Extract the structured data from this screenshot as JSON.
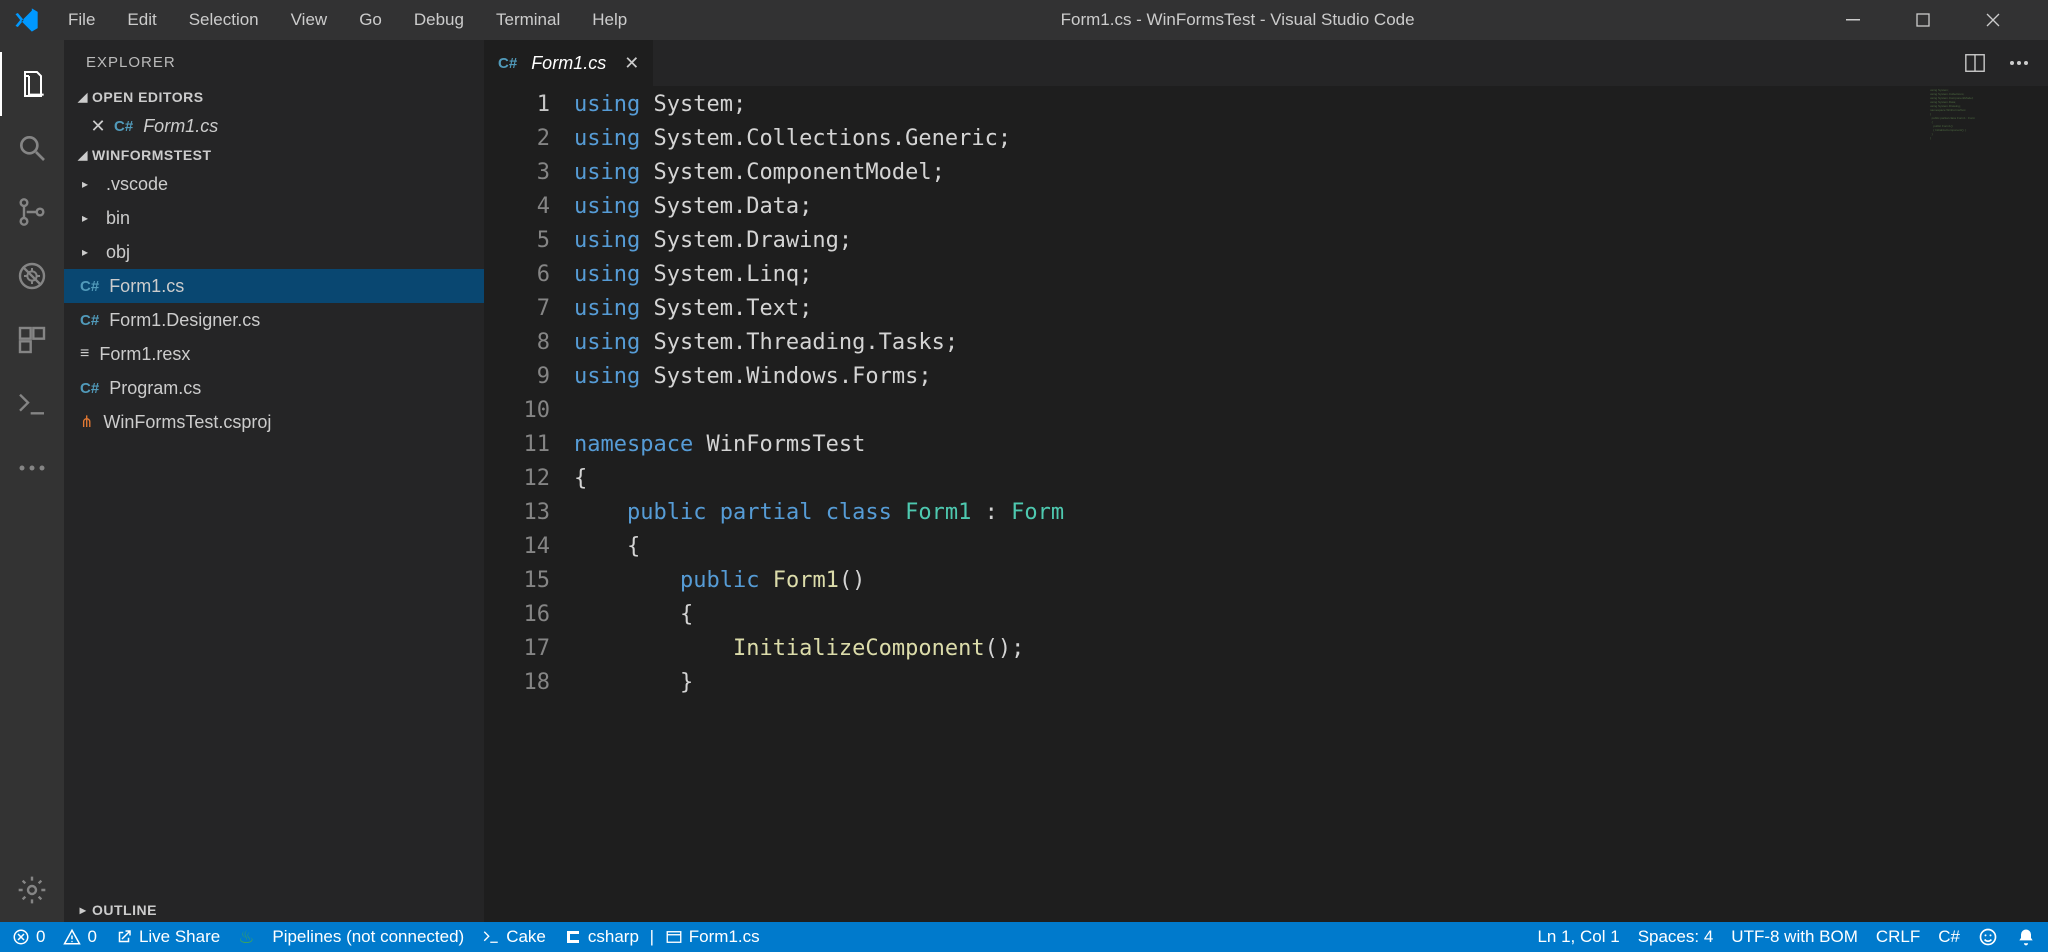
{
  "menu": {
    "items": [
      "File",
      "Edit",
      "Selection",
      "View",
      "Go",
      "Debug",
      "Terminal",
      "Help"
    ]
  },
  "window": {
    "title": "Form1.cs - WinFormsTest - Visual Studio Code"
  },
  "sidebar": {
    "title": "EXPLORER",
    "open_editors_label": "OPEN EDITORS",
    "open_editors": [
      {
        "name": "Form1.cs",
        "italic": true
      }
    ],
    "project_label": "WINFORMSTEST",
    "tree": [
      {
        "type": "folder",
        "name": ".vscode"
      },
      {
        "type": "folder",
        "name": "bin"
      },
      {
        "type": "folder",
        "name": "obj"
      },
      {
        "type": "file",
        "name": "Form1.cs",
        "icon": "cs",
        "selected": true
      },
      {
        "type": "file",
        "name": "Form1.Designer.cs",
        "icon": "cs"
      },
      {
        "type": "file",
        "name": "Form1.resx",
        "icon": "resx"
      },
      {
        "type": "file",
        "name": "Program.cs",
        "icon": "cs"
      },
      {
        "type": "file",
        "name": "WinFormsTest.csproj",
        "icon": "proj"
      }
    ],
    "outline_label": "OUTLINE"
  },
  "tabs": [
    {
      "name": "Form1.cs",
      "italic": true
    }
  ],
  "code": {
    "lines": [
      [
        [
          "kw",
          "using"
        ],
        [
          "plain",
          " System;"
        ]
      ],
      [
        [
          "kw",
          "using"
        ],
        [
          "plain",
          " System.Collections.Generic;"
        ]
      ],
      [
        [
          "kw",
          "using"
        ],
        [
          "plain",
          " System.ComponentModel;"
        ]
      ],
      [
        [
          "kw",
          "using"
        ],
        [
          "plain",
          " System.Data;"
        ]
      ],
      [
        [
          "kw",
          "using"
        ],
        [
          "plain",
          " System.Drawing;"
        ]
      ],
      [
        [
          "kw",
          "using"
        ],
        [
          "plain",
          " System.Linq;"
        ]
      ],
      [
        [
          "kw",
          "using"
        ],
        [
          "plain",
          " System.Text;"
        ]
      ],
      [
        [
          "kw",
          "using"
        ],
        [
          "plain",
          " System.Threading.Tasks;"
        ]
      ],
      [
        [
          "kw",
          "using"
        ],
        [
          "plain",
          " System.Windows.Forms;"
        ]
      ],
      [],
      [
        [
          "kw",
          "namespace"
        ],
        [
          "plain",
          " WinFormsTest"
        ]
      ],
      [
        [
          "plain",
          "{"
        ]
      ],
      [
        [
          "plain",
          "    "
        ],
        [
          "kw",
          "public"
        ],
        [
          "plain",
          " "
        ],
        [
          "kw",
          "partial"
        ],
        [
          "plain",
          " "
        ],
        [
          "kw",
          "class"
        ],
        [
          "plain",
          " "
        ],
        [
          "type",
          "Form1"
        ],
        [
          "plain",
          " : "
        ],
        [
          "type",
          "Form"
        ]
      ],
      [
        [
          "plain",
          "    {"
        ]
      ],
      [
        [
          "plain",
          "        "
        ],
        [
          "kw",
          "public"
        ],
        [
          "plain",
          " "
        ],
        [
          "method",
          "Form1"
        ],
        [
          "plain",
          "()"
        ]
      ],
      [
        [
          "plain",
          "        {"
        ]
      ],
      [
        [
          "plain",
          "            "
        ],
        [
          "method",
          "InitializeComponent"
        ],
        [
          "plain",
          "();"
        ]
      ],
      [
        [
          "plain",
          "        }"
        ]
      ]
    ],
    "current_line": 1
  },
  "status": {
    "errors": "0",
    "warnings": "0",
    "live_share": "Live Share",
    "pipelines": "Pipelines (not connected)",
    "cake": "Cake",
    "csharp": "csharp",
    "active_file": "Form1.cs",
    "ln_col": "Ln 1, Col 1",
    "spaces": "Spaces: 4",
    "encoding": "UTF-8 with BOM",
    "eol": "CRLF",
    "lang": "C#"
  }
}
